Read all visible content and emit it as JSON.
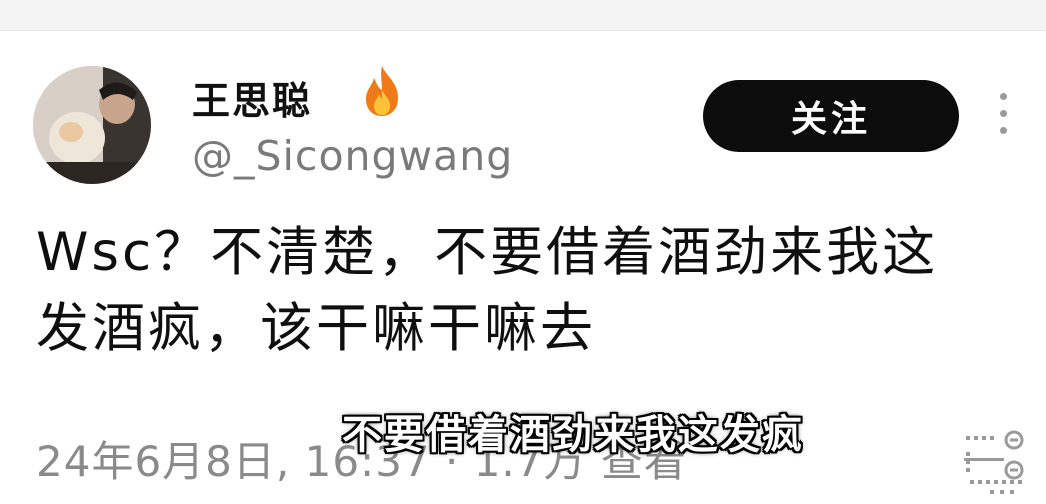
{
  "tweet": {
    "display_name": "王思聪",
    "handle": "@_Sicongwang",
    "follow_label": "关注",
    "text_line1": "Wsc？不清楚，不要借着酒劲来我这",
    "text_line2": "发酒疯，该干嘛干嘛去",
    "date": "24年6月8日, ",
    "time": "16:37",
    "separator": " · ",
    "views": "1.7万",
    "views_label": " 查看"
  },
  "video_caption": "不要借着酒劲来我这发疯",
  "icons": {
    "badge": "fire-icon",
    "more": "more-vertical-icon",
    "translate": "translate-icon",
    "avatar": "avatar"
  },
  "colors": {
    "follow_bg": "#0c0c0c",
    "handle": "#7a7a7a",
    "fire": "#f07a18"
  }
}
